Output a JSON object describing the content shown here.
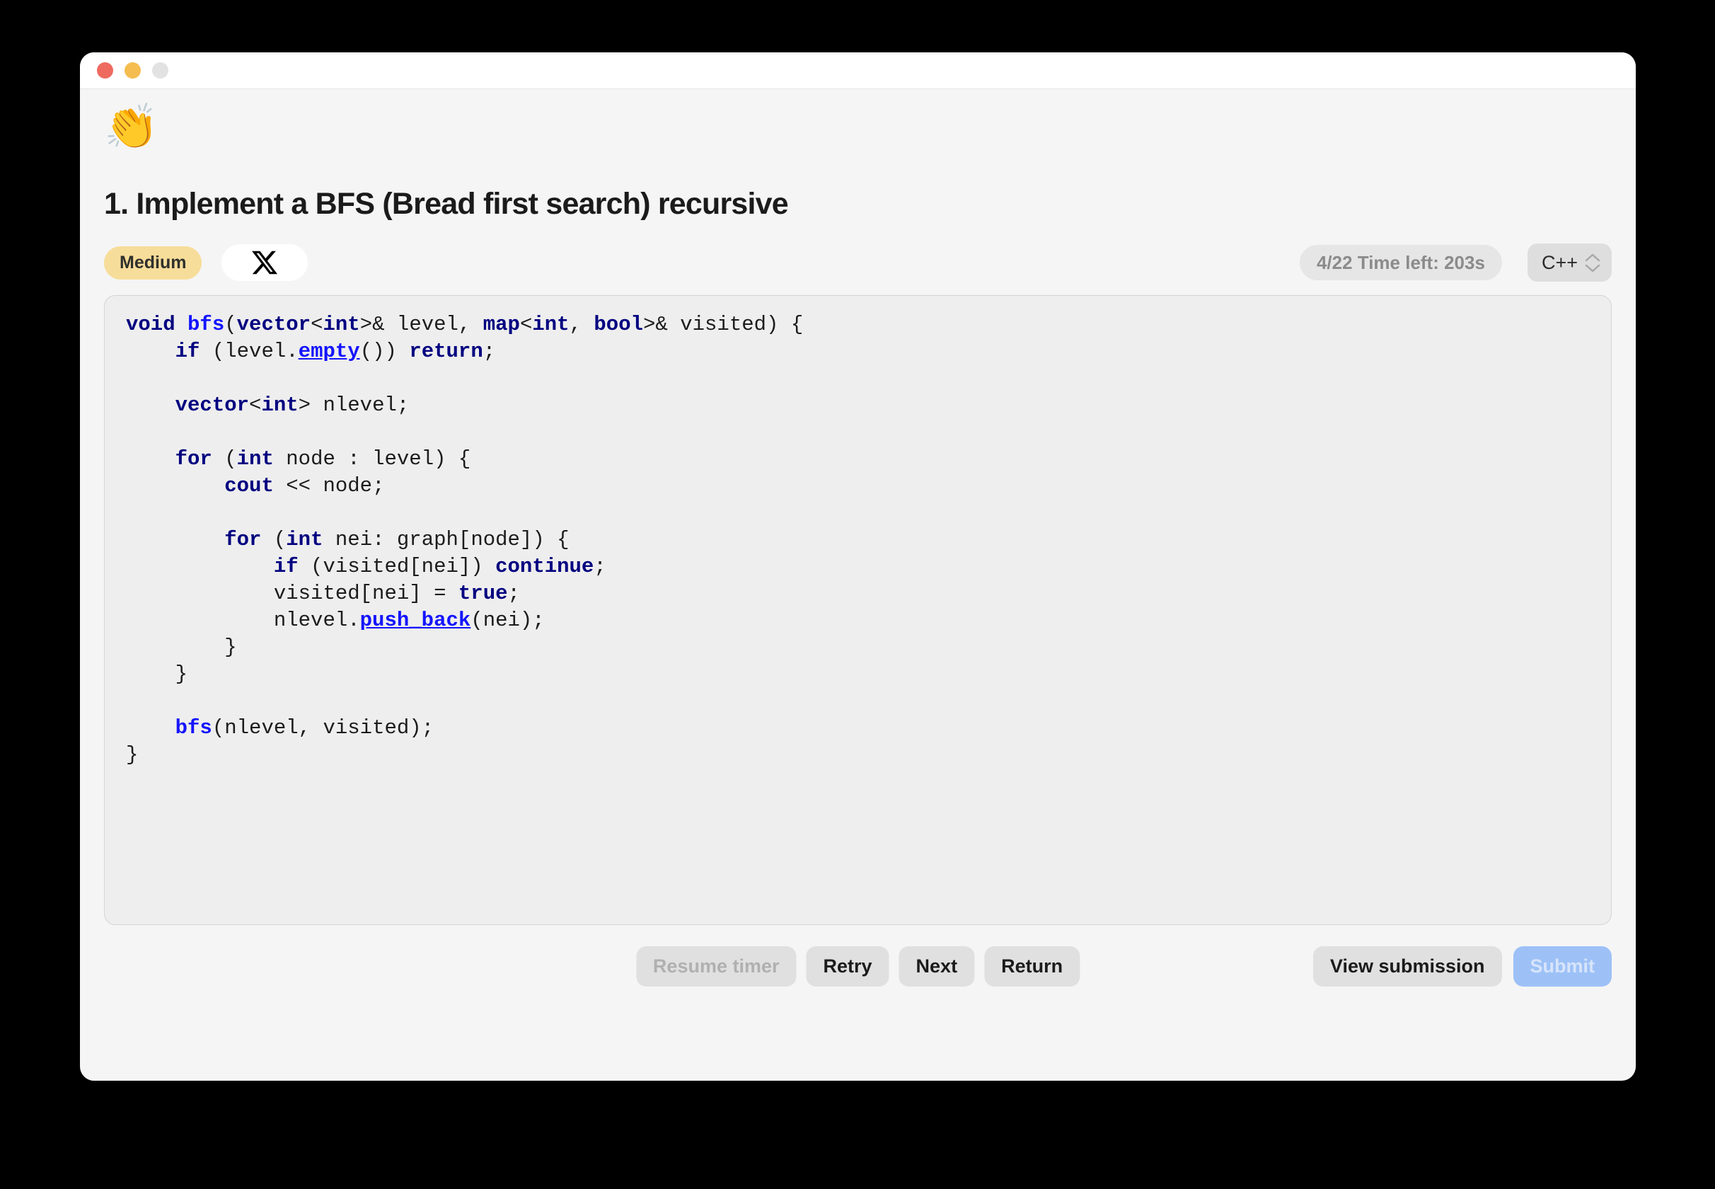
{
  "window": {
    "traffic_lights": [
      {
        "name": "close",
        "color": "#ee6a5f"
      },
      {
        "name": "minimize",
        "color": "#f5bd4f"
      },
      {
        "name": "maximize",
        "color": "#e2e2e2"
      }
    ]
  },
  "header": {
    "emoji": "👏",
    "emoji_name": "clapping-hands-emoji",
    "title": "1. Implement a BFS (Bread first search) recursive"
  },
  "meta": {
    "difficulty": "Medium",
    "difficulty_color": "#f7dd9a",
    "social_icon": "x-logo-icon",
    "timer": "4/22 Time left: 203s",
    "language": "C++"
  },
  "editor": {
    "language": "cpp",
    "code": "void bfs(vector<int>& level, map<int, bool>& visited) {\n    if (level.empty()) return;\n\n    vector<int> nlevel;\n\n    for (int node : level) {\n        cout << node;\n\n        for (int nei: graph[node]) {\n            if (visited[nei]) continue;\n            visited[nei] = true;\n            nlevel.push_back(nei);\n        }\n    }\n\n    bfs(nlevel, visited);\n}"
  },
  "buttons": {
    "resume_timer": "Resume timer",
    "retry": "Retry",
    "next": "Next",
    "return": "Return",
    "view_submission": "View submission",
    "submit": "Submit"
  },
  "colors": {
    "desktop": "#000000",
    "window_body": "#f5f5f5",
    "titlebar": "#ffffff",
    "code_background": "#eeeeee",
    "keyword": "#000080",
    "function": "#1414ff",
    "submit_button": "#9dc1f7"
  }
}
